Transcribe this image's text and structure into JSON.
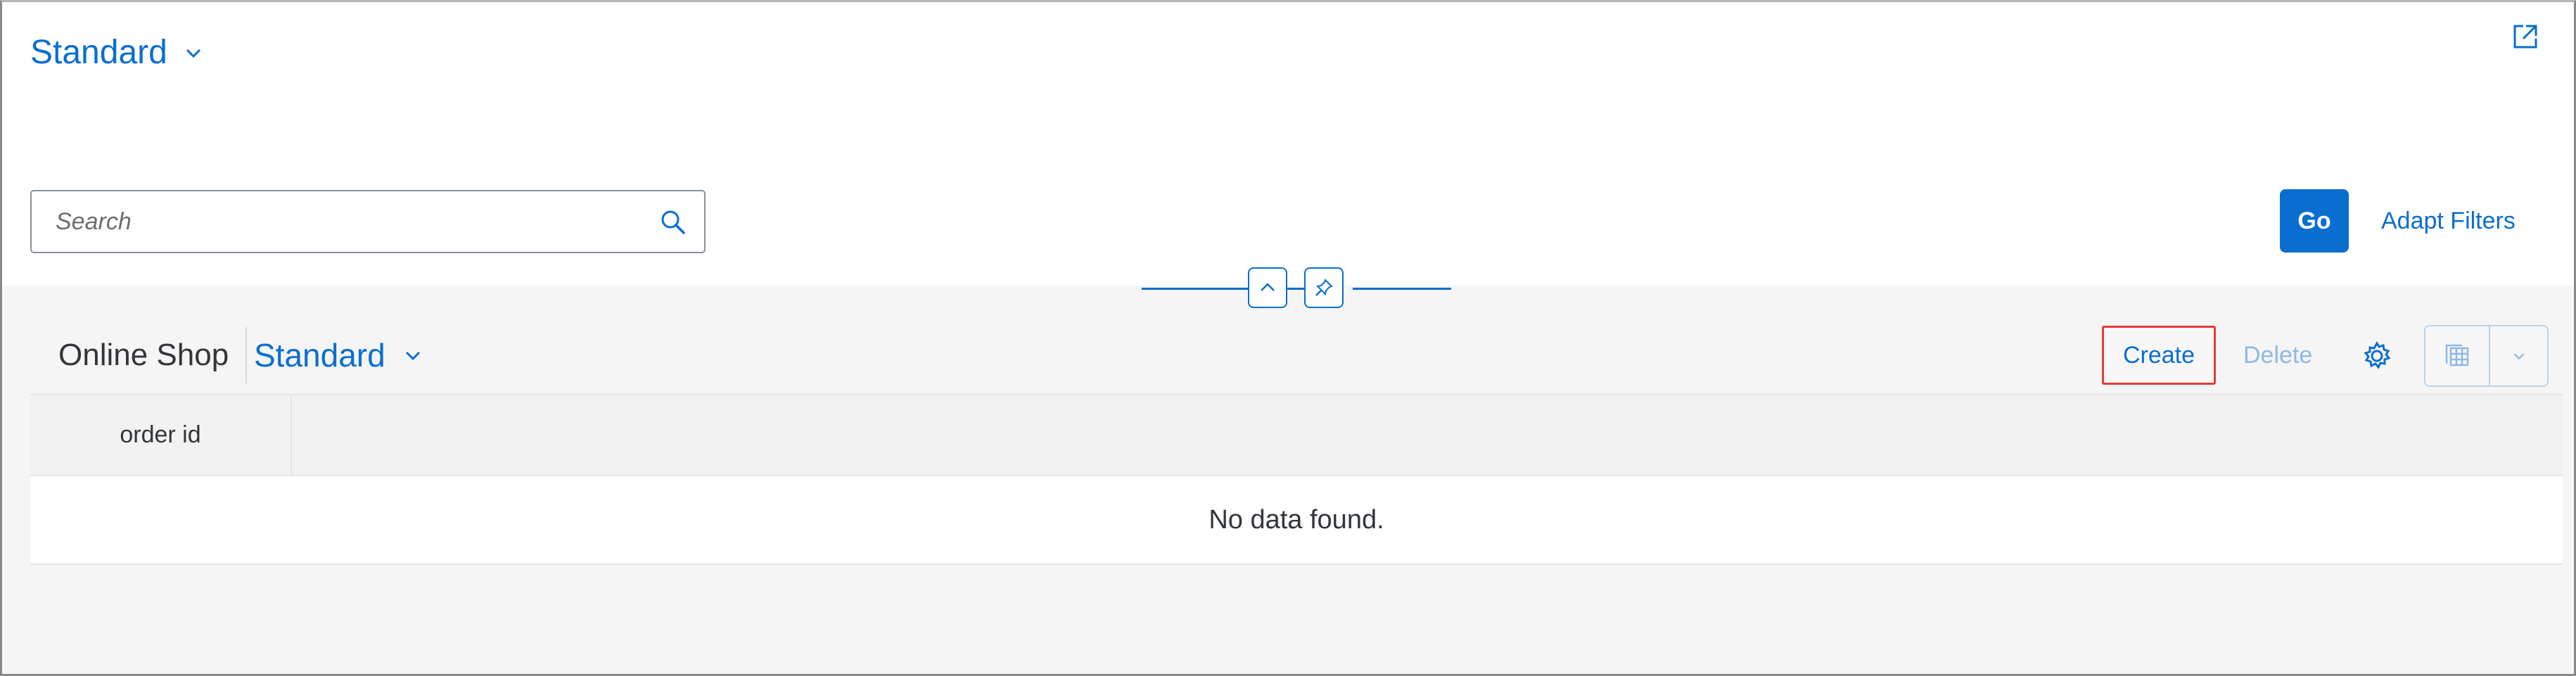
{
  "header": {
    "variant_title": "Standard",
    "search": {
      "placeholder": "Search",
      "value": ""
    },
    "go_label": "Go",
    "adapt_filters_label": "Adapt Filters"
  },
  "table_toolbar": {
    "title": "Online Shop",
    "variant": "Standard",
    "create_label": "Create",
    "delete_label": "Delete"
  },
  "table": {
    "columns": [
      "order id"
    ],
    "rows": [],
    "no_data_text": "No data found."
  },
  "icons": {
    "share": "share-icon",
    "search": "search-icon",
    "collapse": "chevron-up-icon",
    "pin": "pin-icon",
    "settings": "gear-icon",
    "export": "export-spreadsheet-icon",
    "dropdown": "chevron-down-icon"
  },
  "colors": {
    "accent": "#0a6ed1",
    "highlight_border": "#e33b3b",
    "disabled_text": "#8eb9e4"
  }
}
